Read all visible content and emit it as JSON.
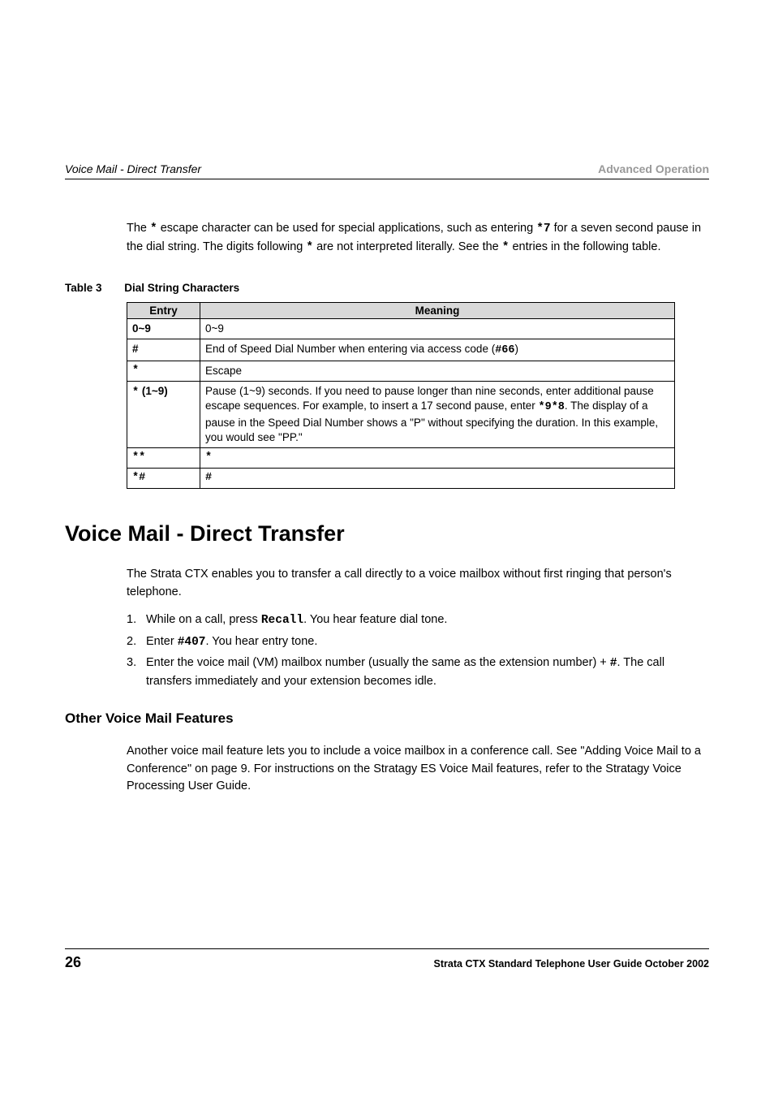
{
  "header": {
    "left": "Voice Mail - Direct Transfer",
    "right": "Advanced Operation"
  },
  "intro": {
    "text_a": "The ",
    "text_b": " escape character can be used for special applications, such as entering ",
    "text_c": " for a seven second pause in the dial string. The digits following ",
    "text_d": " are not interpreted literally. See the ",
    "text_e": " entries in the following table."
  },
  "table": {
    "label_prefix": "Table 3",
    "label_title": "Dial String Characters",
    "head_entry": "Entry",
    "head_meaning": "Meaning",
    "rows": [
      {
        "entry": "0~9",
        "meaning": "0~9"
      },
      {
        "entry": "#",
        "meaning_a": "End of Speed Dial Number when entering via access code (",
        "meaning_b": ")",
        "code": "#66"
      },
      {
        "entry": "*",
        "meaning": "Escape"
      },
      {
        "entry": "* (1~9)",
        "meaning_a": "Pause (1~9) seconds. If you need to pause longer than nine seconds, enter additional pause escape sequences. For example, to insert a 17 second pause, enter ",
        "code": "*9*8",
        "meaning_b": ". The display of a pause in the Speed Dial Number shows a \"P\" without specifying the duration. In this example, you would see \"PP.\""
      },
      {
        "entry": "**",
        "entry_is_code": true,
        "meaning_code": "*"
      },
      {
        "entry": "*#",
        "entry_is_code": true,
        "meaning_code": "#"
      }
    ]
  },
  "section": {
    "h1": "Voice Mail - Direct Transfer",
    "para1": "The Strata CTX enables you to transfer a call directly to a voice mailbox without first ringing that person's telephone.",
    "step1_num": "1.",
    "step1_a": "While on a call, press ",
    "step1_recall": "Recall",
    "step1_b": ". You hear feature dial tone.",
    "step2_num": "2.",
    "step2_a": "Enter ",
    "step2_code": "#407",
    "step2_b": ". You hear entry tone.",
    "step3_num": "3.",
    "step3_a": "Enter the voice mail (VM) mailbox number (usually the same as the extension number) + ",
    "step3_code": "#",
    "step3_b": ". The call transfers immediately and your extension becomes idle.",
    "h2": "Other Voice Mail Features",
    "para2": "Another voice mail feature lets you to include a voice mailbox in a conference call. See \"Adding Voice Mail to a Conference\" on page 9. For instructions on the Stratagy ES Voice Mail features, refer to the Stratagy Voice Processing User Guide."
  },
  "footer": {
    "page": "26",
    "text": "Strata CTX Standard Telephone User Guide   October 2002"
  }
}
